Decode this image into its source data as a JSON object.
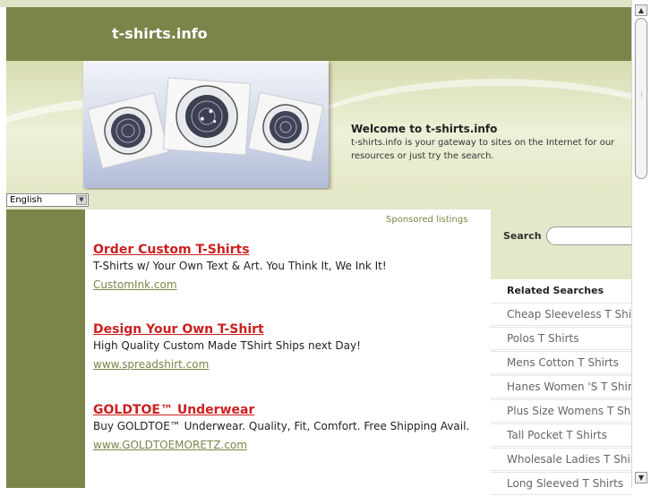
{
  "site": {
    "title": "t-shirts.info"
  },
  "banner": {
    "welcome_title": "Welcome to t-shirts.info",
    "welcome_text": "t-shirts.info is your gateway to sites on the Internet for our resources or just try the search."
  },
  "language": {
    "selected": "English"
  },
  "sponsored_label": "Sponsored listings",
  "listings": [
    {
      "title": "Order Custom T-Shirts",
      "description": "T-Shirts w/ Your Own Text & Art. You Think It, We Ink It!",
      "url": "CustomInk.com"
    },
    {
      "title": "Design Your Own T-Shirt",
      "description": "High Quality Custom Made TShirt Ships next Day!",
      "url": "www.spreadshirt.com"
    },
    {
      "title": "GOLDTOE™ Underwear",
      "description": "Buy GOLDTOE™ Underwear. Quality, Fit, Comfort. Free Shipping Avail.",
      "url": "www.GOLDTOEMORETZ.com"
    }
  ],
  "search": {
    "label": "Search",
    "value": ""
  },
  "related": {
    "heading": "Related Searches",
    "items": [
      "Cheap Sleeveless T Shirts",
      "Polos T Shirts",
      "Mens Cotton T Shirts",
      "Hanes Women 'S T Shirts",
      "Plus Size Womens T Shirts",
      "Tall Pocket T Shirts",
      "Wholesale Ladies T Shirts",
      "Long Sleeved T Shirts"
    ]
  },
  "colors": {
    "olive": "#7d8449",
    "link_red": "#cc2020",
    "light_olive": "#e4e7c9"
  },
  "icons": {
    "language_dropdown": "chevron-down-icon",
    "scroll_up": "arrow-up-icon",
    "scroll_down": "arrow-down-icon"
  }
}
